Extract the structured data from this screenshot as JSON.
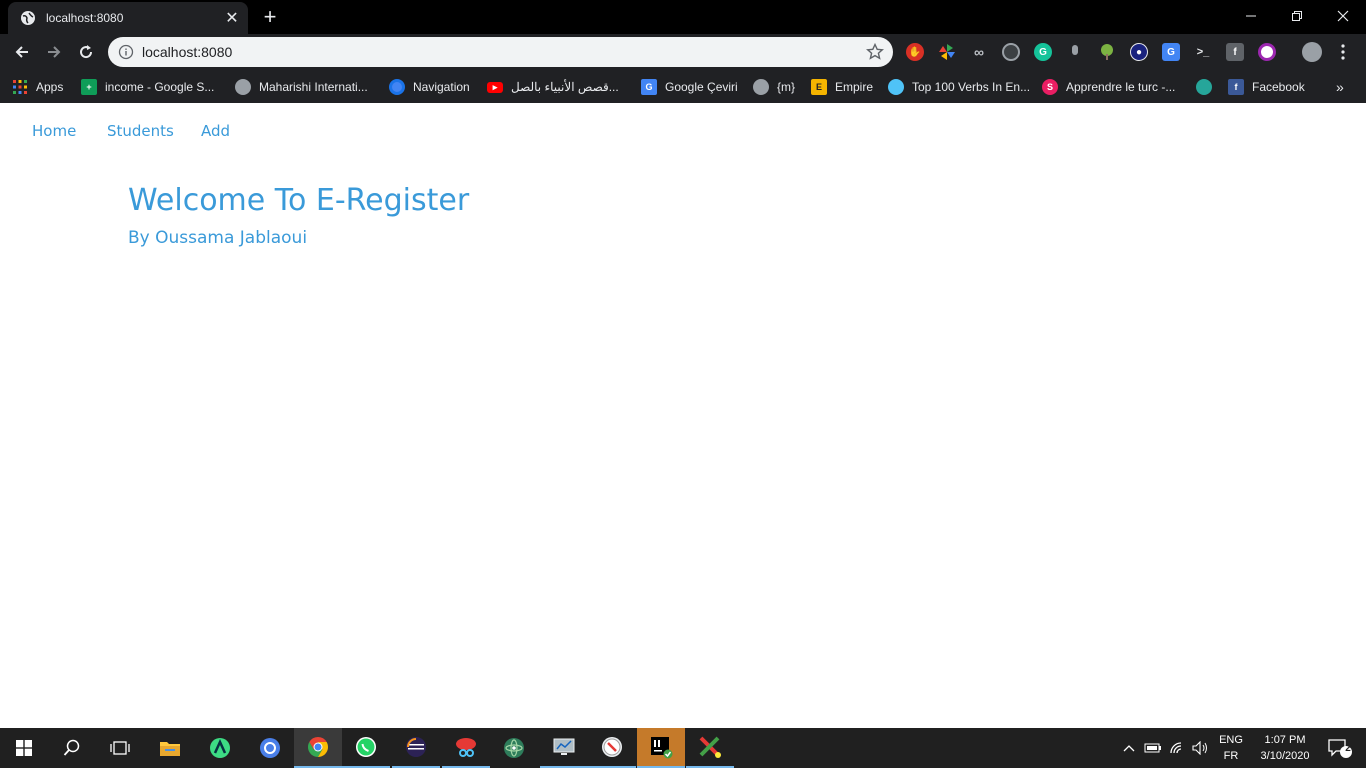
{
  "browser": {
    "tab_title": "localhost:8080",
    "url": "localhost:8080",
    "new_tab_symbol": "+",
    "close_symbol": "✕"
  },
  "bookmarks": [
    {
      "label": "Apps",
      "icon": "apps-grid-icon",
      "color": "#ea4335"
    },
    {
      "label": "income - Google S...",
      "icon": "sheets-icon",
      "color": "#0f9d58"
    },
    {
      "label": "Maharishi Internati...",
      "icon": "globe-icon",
      "color": "#9aa0a6"
    },
    {
      "label": "Navigation",
      "icon": "navigation-icon",
      "color": "#4285f4"
    },
    {
      "label": "قصص الأنبياء بالصل...",
      "icon": "youtube-icon",
      "color": "#ff0000"
    },
    {
      "label": "Google Çeviri",
      "icon": "translate-icon",
      "color": "#4285f4"
    },
    {
      "label": "{m}",
      "icon": "globe-icon",
      "color": "#9aa0a6"
    },
    {
      "label": "Empire",
      "icon": "empire-icon",
      "color": "#f4b400"
    },
    {
      "label": "Top 100 Verbs In En...",
      "icon": "paw-icon",
      "color": "#4fc3f7"
    },
    {
      "label": "Apprendre le turc -...",
      "icon": "hexagon-icon",
      "color": "#e91e63"
    },
    {
      "label": "",
      "icon": "bird-icon",
      "color": "#26a69a"
    },
    {
      "label": "Facebook",
      "icon": "facebook-icon",
      "color": "#3b5998"
    }
  ],
  "site": {
    "nav": {
      "home": "Home",
      "students": "Students",
      "add": "Add"
    },
    "heading": "Welcome To E-Register",
    "subheading": "By Oussama Jablaoui"
  },
  "taskbar": {
    "lang_top": "ENG",
    "lang_bottom": "FR",
    "time": "1:07 PM",
    "date": "3/10/2020",
    "notification_count": "2"
  },
  "colors": {
    "link_blue": "#3a9ad9",
    "chrome_dark": "#202124"
  }
}
